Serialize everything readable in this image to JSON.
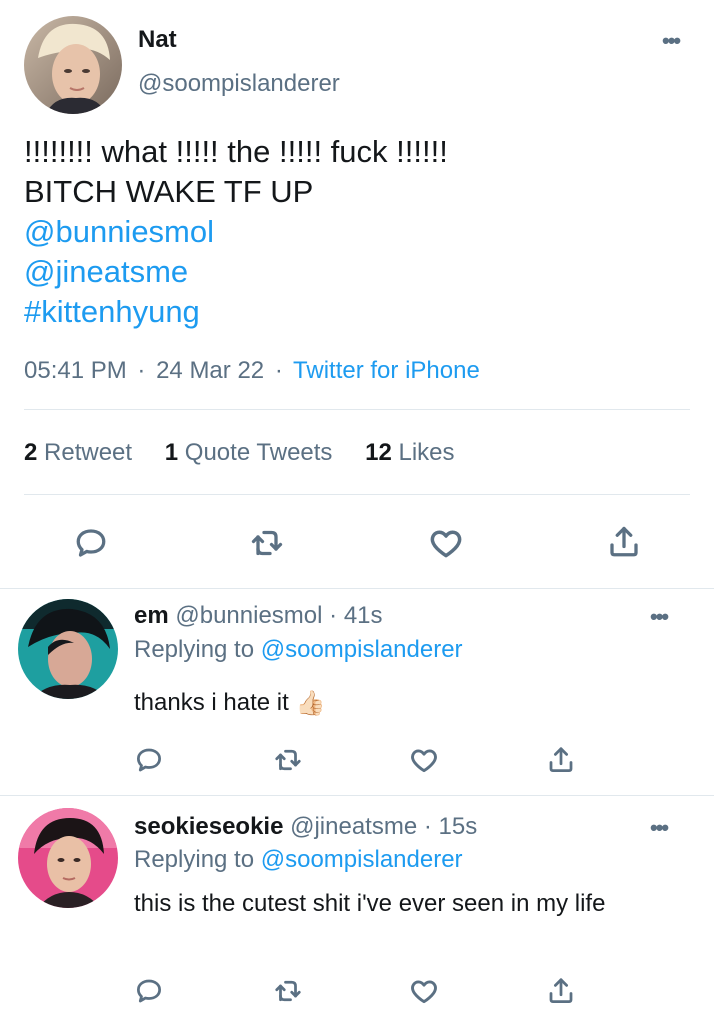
{
  "main_tweet": {
    "author_name": "Nat",
    "author_handle": "@soompislanderer",
    "text_line1": "!!!!!!!! what !!!!! the !!!!! fuck !!!!!!",
    "text_line2": "BITCH WAKE TF UP",
    "mention1": "@bunniesmol",
    "mention2": "@jineatsme",
    "hashtag": "#kittenhyung",
    "time": "05:41 PM",
    "dot1": "·",
    "date": "24 Mar 22",
    "dot2": "·",
    "source": "Twitter for iPhone",
    "retweet_count": "2",
    "retweet_label": "Retweet",
    "quote_count": "1",
    "quote_label": "Quote Tweets",
    "like_count": "12",
    "like_label": "Likes"
  },
  "replies": [
    {
      "name": "em",
      "handle": "@bunniesmol",
      "dot": "·",
      "time": "41s",
      "replying_label": "Replying to",
      "replying_to": "@soompislanderer",
      "text": "thanks i hate it",
      "emoji": "👍🏻"
    },
    {
      "name": "seokieseokie",
      "handle": "@jineatsme",
      "dot": "·",
      "time": "15s",
      "replying_label": "Replying to",
      "replying_to": "@soompislanderer",
      "text": "this is the cutest shit i've ever seen in my life"
    }
  ],
  "icons": [
    "reply-icon",
    "retweet-icon",
    "like-icon",
    "share-icon",
    "more-icon"
  ],
  "colors": {
    "link": "#1d9bf0",
    "secondary_text": "#5b7083",
    "divider": "#e1e8ed"
  }
}
